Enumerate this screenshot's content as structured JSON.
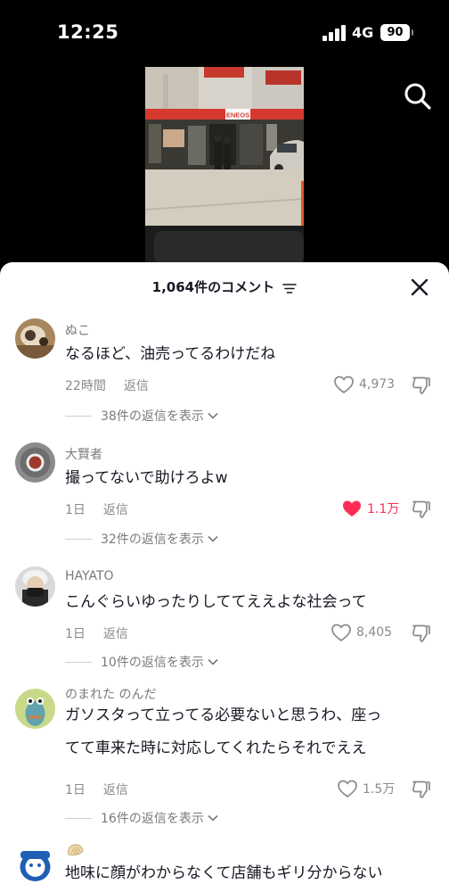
{
  "status_bar": {
    "time": "12:25",
    "network": "4G",
    "battery": "90"
  },
  "comments_header": {
    "title": "1,064件のコメント"
  },
  "comments": [
    {
      "username": "ぬこ",
      "text": [
        "なるほど、油売ってるわけだね"
      ],
      "time": "22時間",
      "reply_label": "返信",
      "likes": "4,973",
      "liked": false,
      "view_replies": "38件の返信を表示"
    },
    {
      "username": "大賢者",
      "text": [
        "撮ってないで助けろよw"
      ],
      "time": "1日",
      "reply_label": "返信",
      "likes": "1.1万",
      "liked": true,
      "view_replies": "32件の返信を表示"
    },
    {
      "username": "HAYATO",
      "text": [
        "こんぐらいゆったりしててええよな社会って"
      ],
      "time": "1日",
      "reply_label": "返信",
      "likes": "8,405",
      "liked": false,
      "view_replies": "10件の返信を表示"
    },
    {
      "username": "のまれた のんだ",
      "text": [
        "ガソスタって立ってる必要ないと思うわ、座っ",
        "てて車来た時に対応してくれたらそれでええ"
      ],
      "time": "1日",
      "reply_label": "返信",
      "likes": "1.5万",
      "liked": false,
      "view_replies": "16件の返信を表示"
    },
    {
      "username": "",
      "text": [
        "地味に顔がわからなくて店舗もギリ分からない"
      ]
    }
  ],
  "video_scene": {
    "store_sign": "ENEOS"
  },
  "colors": {
    "like_active": "#fe2c55",
    "text_primary": "#161823",
    "text_secondary": "#8a8a8a"
  }
}
